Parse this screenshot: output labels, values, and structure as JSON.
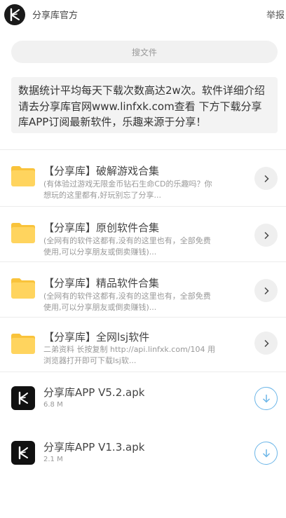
{
  "header": {
    "owner_name": "分享库官方",
    "report_label": "举报"
  },
  "search": {
    "placeholder": "搜文件"
  },
  "notice": {
    "text": "数据统计平均每天下载次数高达2w次。软件详细介绍请去分享库官网www.linfxk.com查看 下方下载分享库APP订阅最新软件，乐趣来源于分享！"
  },
  "folders": [
    {
      "title": "【分享库】破解游戏合集",
      "desc": "(有体验过游戏无限金币钻石生命CD的乐趣吗？你想玩的这里都有,好玩别忘了分享..."
    },
    {
      "title": "【分享库】原创软件合集",
      "desc": "(全网有的软件这都有,没有的这里也有，全部免费使用,可以分享朋友或倒卖赚钱)..."
    },
    {
      "title": "【分享库】精品软件合集",
      "desc": "(全网有的软件这都有,没有的这里也有，全部免费使用,可以分享朋友或倒卖赚钱)..."
    },
    {
      "title": "【分享库】全网lsj软件",
      "desc": "二弟资料 长按复制 http://api.linfxk.com/104 用浏览器打开即可下载lsj软..."
    }
  ],
  "files": [
    {
      "name": "分享库APP V5.2.apk",
      "size": "6.8 M"
    },
    {
      "name": "分享库APP V1.3.apk",
      "size": "2.1 M"
    }
  ],
  "colors": {
    "folder": "#ffd45e",
    "folder_tab": "#f9c33b",
    "download_accent": "#6cb6e8",
    "icon_dark": "#111111"
  }
}
